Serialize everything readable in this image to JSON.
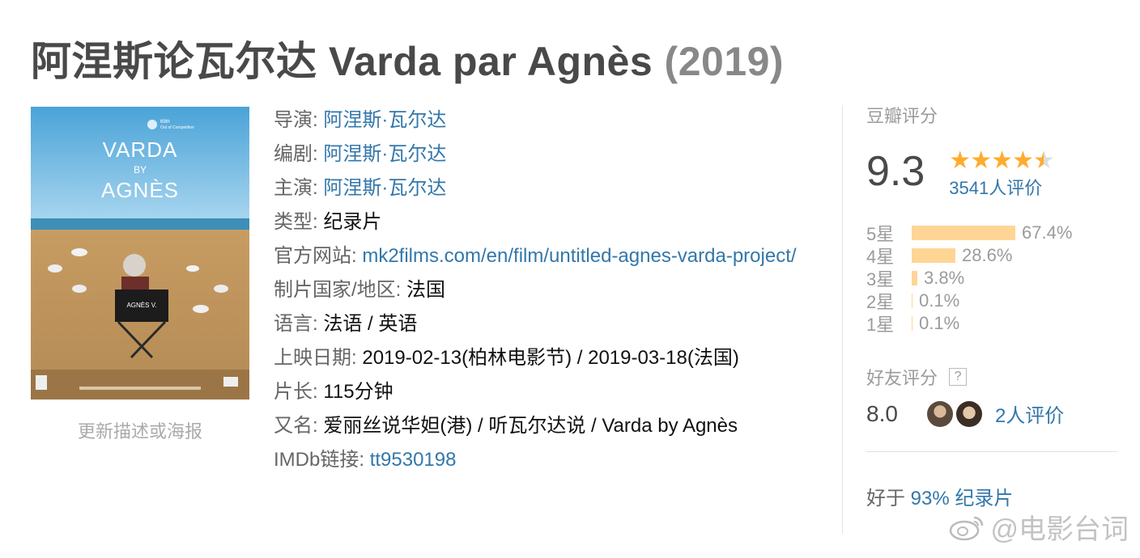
{
  "title": {
    "main": "阿涅斯论瓦尔达 Varda par Agnès",
    "year": "(2019)"
  },
  "poster": {
    "festival_line1": "69th",
    "festival_line2": "Out of Competition",
    "headline1": "VARDA",
    "headline2": "BY",
    "headline3": "AGNÈS",
    "chair_text": "AGNÈS V.",
    "update_link": "更新描述或海报"
  },
  "info": {
    "director_label": "导演:",
    "director": "阿涅斯·瓦尔达",
    "writer_label": "编剧:",
    "writer": "阿涅斯·瓦尔达",
    "cast_label": "主演:",
    "cast": "阿涅斯·瓦尔达",
    "genre_label": "类型:",
    "genre": "纪录片",
    "website_label": "官方网站:",
    "website": "mk2films.com/en/film/untitled-agnes-varda-project/",
    "country_label": "制片国家/地区:",
    "country": "法国",
    "language_label": "语言:",
    "language": "法语 / 英语",
    "release_label": "上映日期:",
    "release": "2019-02-13(柏林电影节) / 2019-03-18(法国)",
    "runtime_label": "片长:",
    "runtime": "115分钟",
    "aka_label": "又名:",
    "aka": "爱丽丝说华妲(港) / 听瓦尔达说 / Varda by Agnès",
    "imdb_label": "IMDb链接:",
    "imdb": "tt9530198"
  },
  "rating": {
    "heading": "豆瓣评分",
    "score": "9.3",
    "stars_full": "★★★★",
    "stars_half": "★",
    "votes": "3541人评价",
    "distribution": [
      {
        "label": "5星",
        "percent": "67.4%",
        "value": 67.4
      },
      {
        "label": "4星",
        "percent": "28.6%",
        "value": 28.6
      },
      {
        "label": "3星",
        "percent": "3.8%",
        "value": 3.8
      },
      {
        "label": "2星",
        "percent": "0.1%",
        "value": 0.1
      },
      {
        "label": "1星",
        "percent": "0.1%",
        "value": 0.1
      }
    ],
    "friend_heading": "好友评分",
    "friend_help": "?",
    "friend_score": "8.0",
    "friend_votes": "2人评价",
    "better_prefix": "好于 ",
    "better_link": "93% 纪录片"
  },
  "watermark": {
    "text": "@电影台词"
  },
  "colors": {
    "link": "#3377aa",
    "bar": "#ffd596",
    "star": "#ffac2d",
    "title": "#494949"
  }
}
